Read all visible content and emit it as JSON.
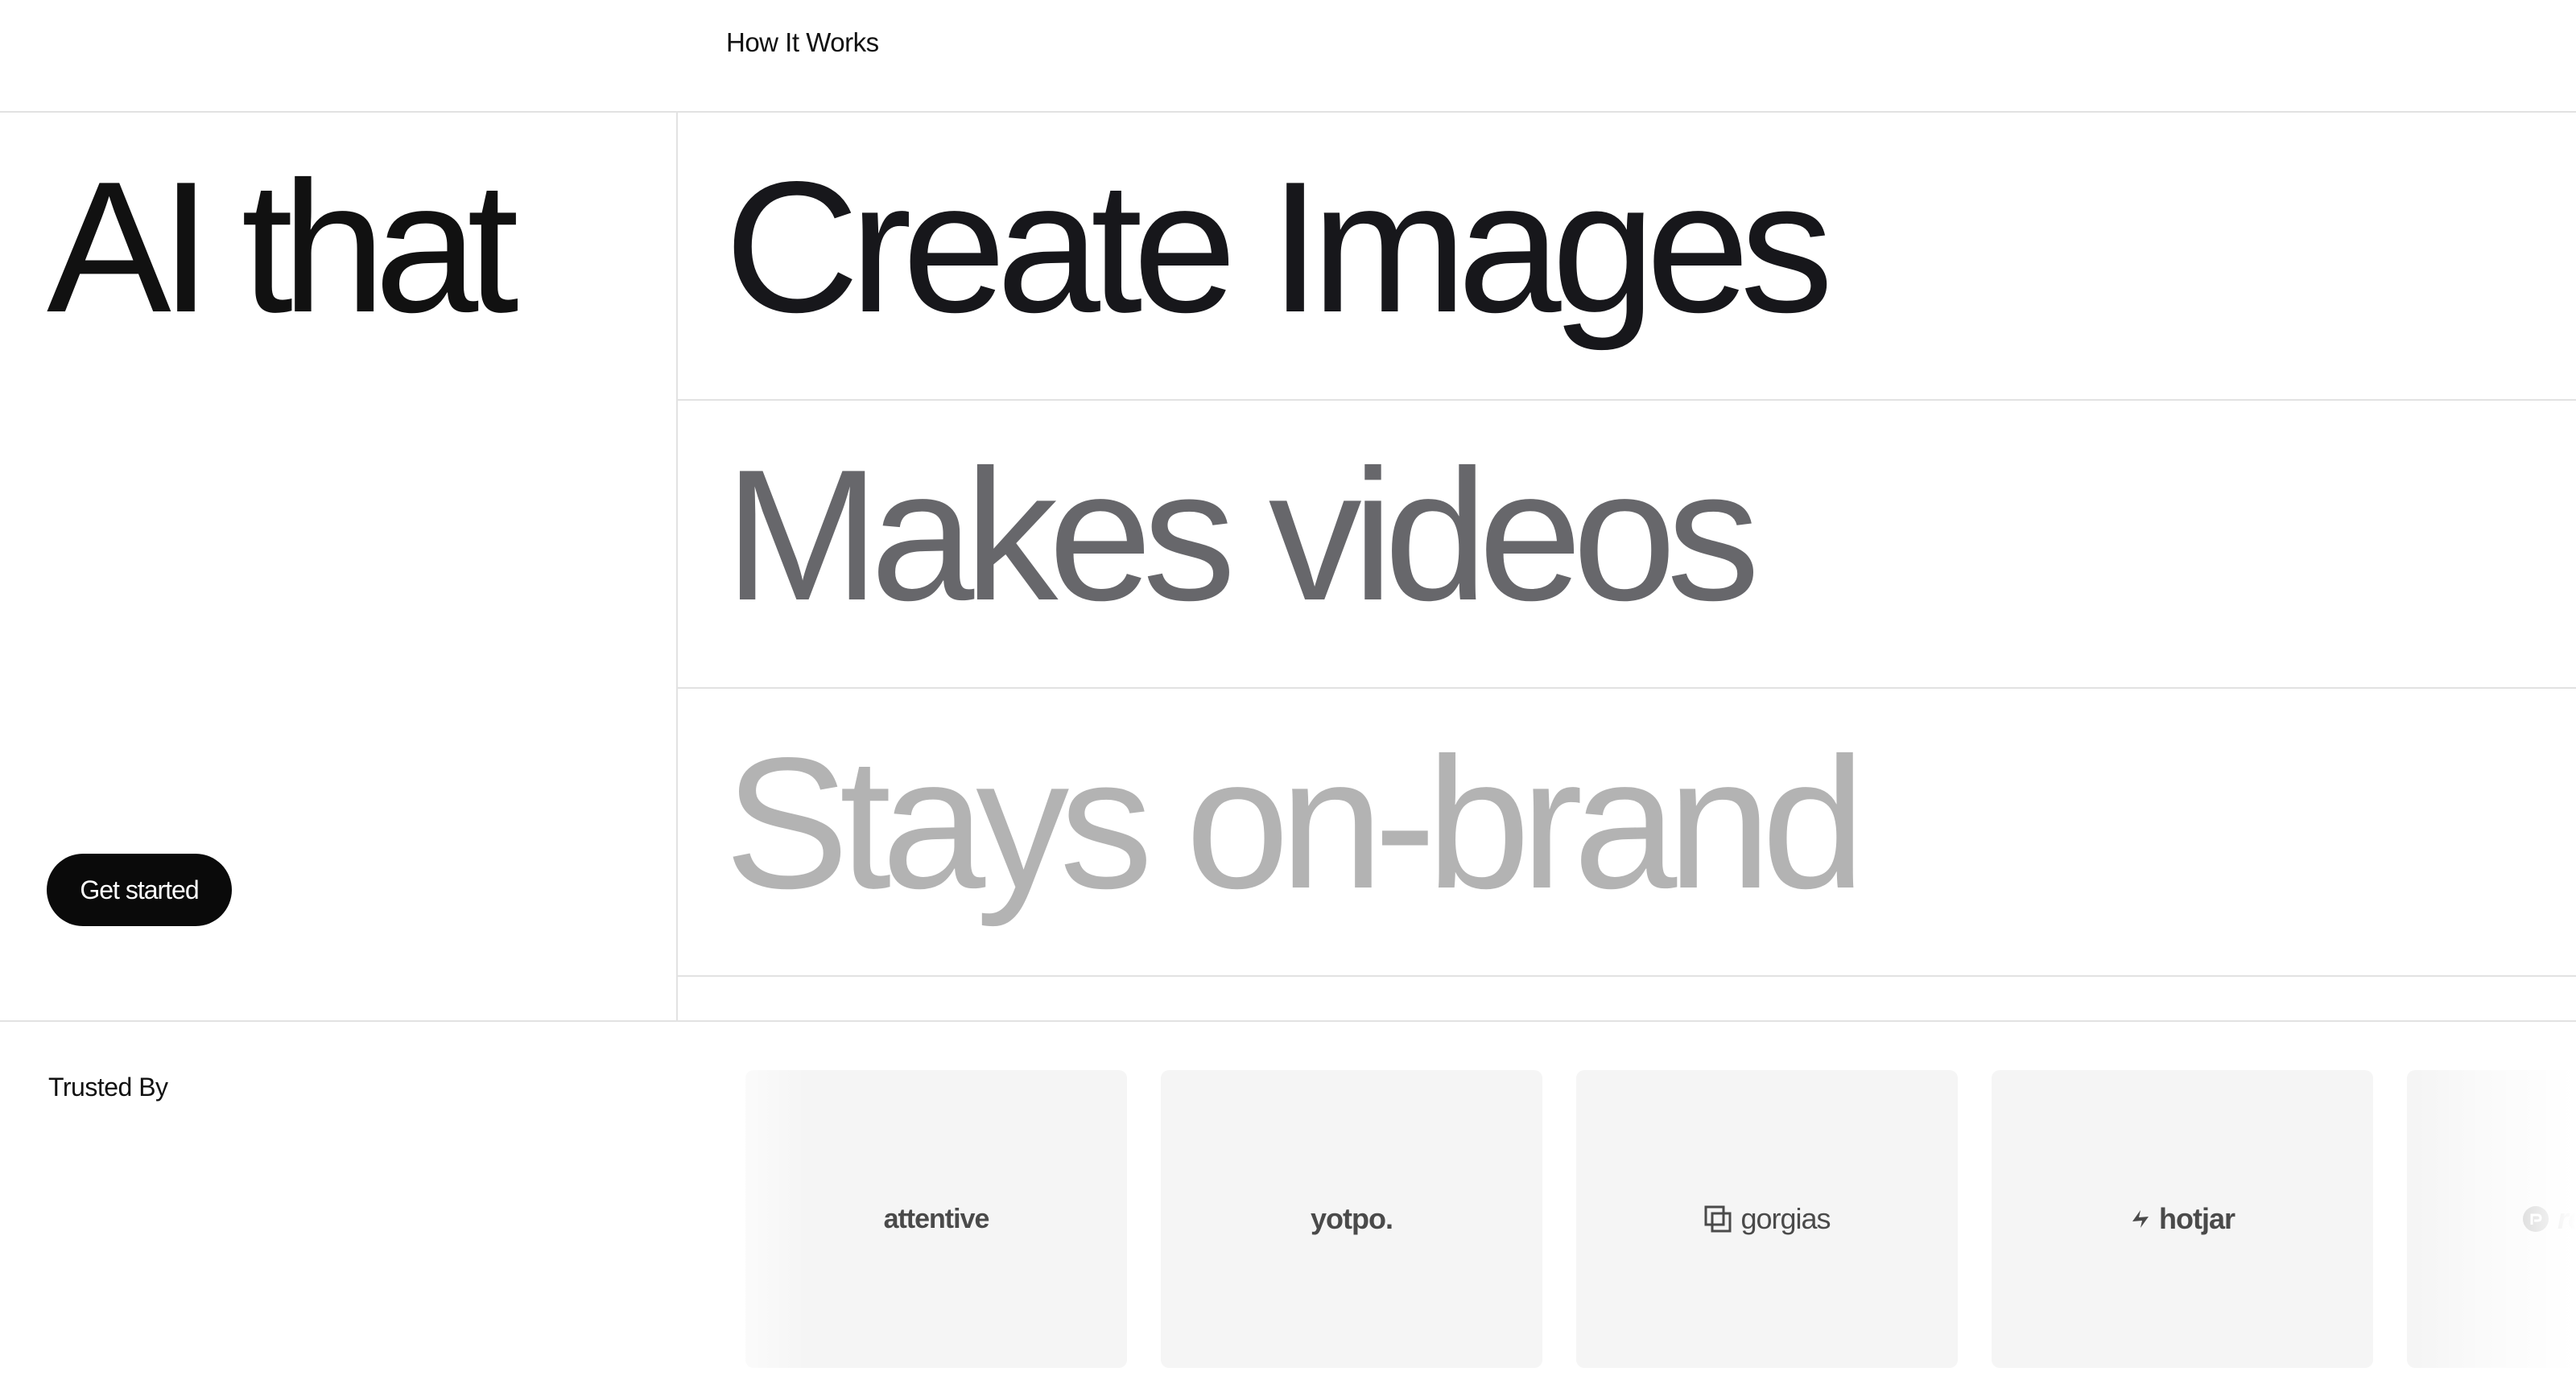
{
  "nav": {
    "how_it_works": "How It Works"
  },
  "hero": {
    "title": "AI that",
    "cta_label": "Get started",
    "rows": [
      "Create Images",
      "Makes videos",
      "Stays on-brand"
    ]
  },
  "trusted": {
    "label": "Trusted By",
    "logos": [
      {
        "name": "attentive",
        "text": "attentive",
        "icon": "none"
      },
      {
        "name": "yotpo",
        "text": "yotpo.",
        "icon": "none"
      },
      {
        "name": "gorgias",
        "text": "gorgias",
        "icon": "gorgias-square-icon"
      },
      {
        "name": "hotjar",
        "text": "hotjar",
        "icon": "hotjar-mark-icon"
      },
      {
        "name": "recharge",
        "text": "recharge",
        "icon": "recharge-circle-icon"
      }
    ]
  },
  "colors": {
    "row1": "#17171b",
    "row2": "#67676b",
    "row3": "#b3b3b3",
    "cta_bg": "#0a0a0a",
    "logo_card_bg": "#f5f5f5",
    "divider": "#e2e2e2"
  }
}
